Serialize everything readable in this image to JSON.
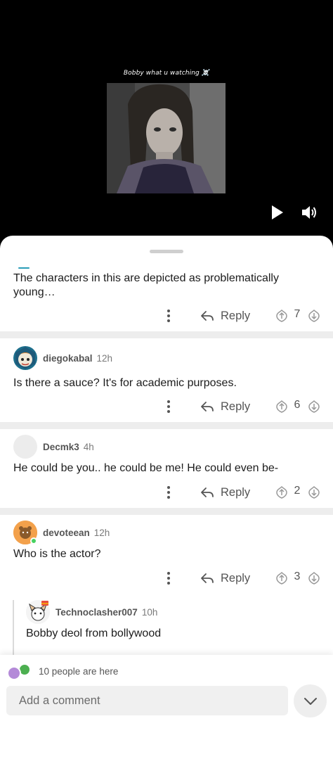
{
  "video": {
    "caption": "Bobby what u watching ☠️"
  },
  "comments": [
    {
      "text": "The characters in this are depicted as problematically young…",
      "reply_label": "Reply",
      "vote_count": "7"
    },
    {
      "username": "diegokabal",
      "time": "12h",
      "text": "Is there a sauce? It's for academic purposes.",
      "reply_label": "Reply",
      "vote_count": "6"
    },
    {
      "username": "Decmk3",
      "time": "4h",
      "text": "He could be you.. he could be me! He could even be-",
      "reply_label": "Reply",
      "vote_count": "2"
    },
    {
      "username": "devoteean",
      "time": "12h",
      "text": "Who is the actor?",
      "reply_label": "Reply",
      "vote_count": "3"
    },
    {
      "username": "Technoclasher007",
      "time": "10h",
      "text": "Bobby deol from bollywood"
    }
  ],
  "footer": {
    "presence_text": "10 people are here",
    "comment_placeholder": "Add a comment"
  },
  "colors": {
    "background_dark": "#000000",
    "sheet": "#ffffff",
    "separator": "#ededed",
    "online_dot": "#46d160"
  }
}
